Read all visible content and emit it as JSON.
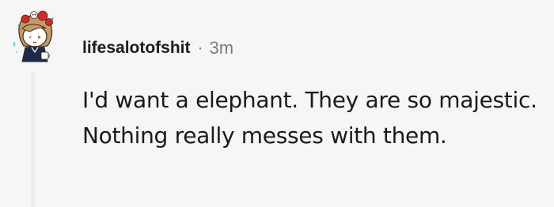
{
  "comment": {
    "author": "lifesalotofshit",
    "separator": "·",
    "timestamp": "3m",
    "text": "I'd want a elephant. They are so majestic. Nothing really messes with them.",
    "avatar_icon": "snoo-avatar-with-flower-crown-icon"
  },
  "colors": {
    "background": "#f6f6f6",
    "text": "#1a1a1b",
    "meta_text": "#7c7c7c",
    "thread_line": "#ebebeb"
  }
}
